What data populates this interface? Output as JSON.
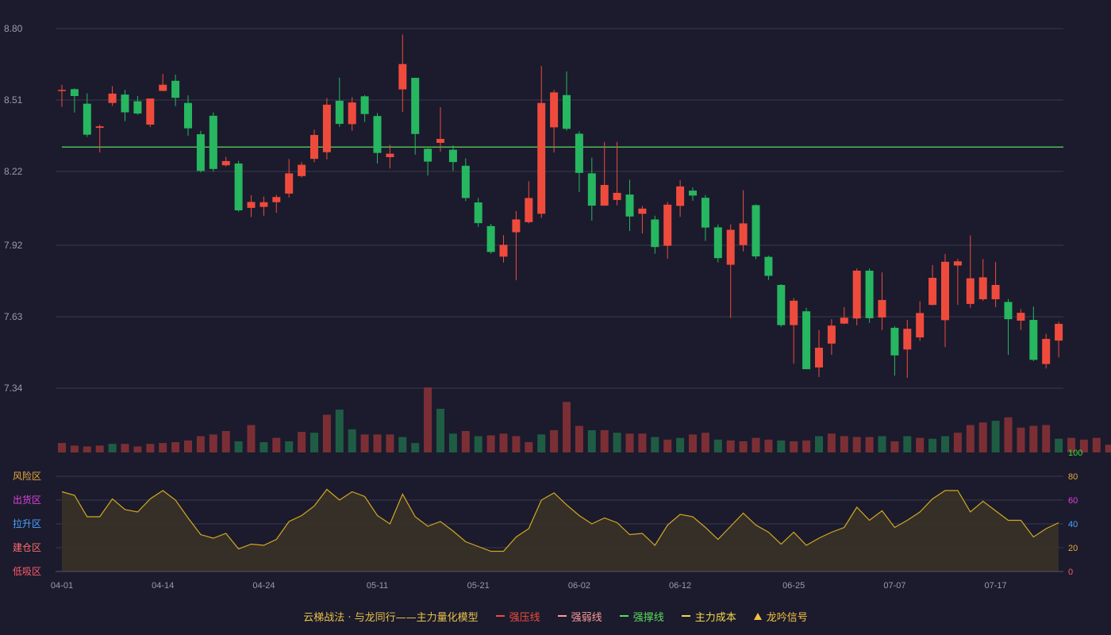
{
  "chart_data": {
    "type": "candlestick",
    "title": "",
    "dates": [
      "04-01",
      "04-02",
      "04-03",
      "04-07",
      "04-08",
      "04-09",
      "04-10",
      "04-11",
      "04-14",
      "04-15",
      "04-16",
      "04-17",
      "04-18",
      "04-21",
      "04-22",
      "04-23",
      "04-24",
      "04-25",
      "04-28",
      "04-29",
      "04-30",
      "05-06",
      "05-07",
      "05-08",
      "05-09",
      "05-11",
      "05-12",
      "05-13",
      "05-14",
      "05-15",
      "05-16",
      "05-19",
      "05-20",
      "05-21",
      "05-22",
      "05-23",
      "05-26",
      "05-27",
      "05-28",
      "05-29",
      "05-30",
      "06-02",
      "06-03",
      "06-04",
      "06-05",
      "06-06",
      "06-09",
      "06-10",
      "06-11",
      "06-12",
      "06-13",
      "06-16",
      "06-17",
      "06-18",
      "06-19",
      "06-20",
      "06-23",
      "06-24",
      "06-25",
      "06-26",
      "06-27",
      "06-30",
      "07-01",
      "07-02",
      "07-03",
      "07-04",
      "07-07",
      "07-08",
      "07-09",
      "07-10",
      "07-11",
      "07-14",
      "07-15",
      "07-16",
      "07-17",
      "07-18",
      "07-21",
      "07-22",
      "07-23",
      "07-24",
      "07-25",
      "07-28",
      "07-29",
      "07-30",
      "07-31"
    ],
    "x_tick_labels": [
      "04-01",
      "04-14",
      "04-24",
      "05-11",
      "05-21",
      "06-02",
      "06-12",
      "06-25",
      "07-07",
      "07-17"
    ],
    "price_y_ticks": [
      "8.80",
      "8.51",
      "8.22",
      "7.92",
      "7.63",
      "7.34"
    ],
    "price_ylim": [
      7.34,
      8.8
    ],
    "candles": [
      [
        8.551,
        8.551,
        8.572,
        8.482
      ],
      [
        8.554,
        8.526,
        8.557,
        8.459
      ],
      [
        8.495,
        8.369,
        8.537,
        8.36
      ],
      [
        8.397,
        8.403,
        8.41,
        8.297
      ],
      [
        8.498,
        8.536,
        8.566,
        8.486
      ],
      [
        8.532,
        8.46,
        8.551,
        8.424
      ],
      [
        8.505,
        8.455,
        8.526,
        8.45
      ],
      [
        8.41,
        8.516,
        8.516,
        8.4
      ],
      [
        8.547,
        8.572,
        8.616,
        8.546
      ],
      [
        8.588,
        8.519,
        8.613,
        8.485
      ],
      [
        8.498,
        8.395,
        8.529,
        8.365
      ],
      [
        8.371,
        8.222,
        8.385,
        8.216
      ],
      [
        8.446,
        8.23,
        8.46,
        8.219
      ],
      [
        8.245,
        8.262,
        8.279,
        8.24
      ],
      [
        8.252,
        8.062,
        8.263,
        8.056
      ],
      [
        8.072,
        8.096,
        8.123,
        8.035
      ],
      [
        8.076,
        8.095,
        8.118,
        8.04
      ],
      [
        8.095,
        8.116,
        8.125,
        8.052
      ],
      [
        8.13,
        8.212,
        8.27,
        8.114
      ],
      [
        8.201,
        8.247,
        8.258,
        8.195
      ],
      [
        8.271,
        8.368,
        8.39,
        8.257
      ],
      [
        8.298,
        8.491,
        8.518,
        8.269
      ],
      [
        8.507,
        8.413,
        8.601,
        8.401
      ],
      [
        8.412,
        8.5,
        8.522,
        8.385
      ],
      [
        8.525,
        8.453,
        8.53,
        8.421
      ],
      [
        8.445,
        8.295,
        8.457,
        8.252
      ],
      [
        8.278,
        8.292,
        8.328,
        8.232
      ],
      [
        8.553,
        8.656,
        8.776,
        8.461
      ],
      [
        8.6,
        8.372,
        8.6,
        8.288
      ],
      [
        8.312,
        8.26,
        8.314,
        8.203
      ],
      [
        8.336,
        8.352,
        8.481,
        8.3
      ],
      [
        8.308,
        8.258,
        8.326,
        8.222
      ],
      [
        8.243,
        8.112,
        8.273,
        8.1
      ],
      [
        8.094,
        8.01,
        8.112,
        7.995
      ],
      [
        7.998,
        7.893,
        8.007,
        7.886
      ],
      [
        7.874,
        7.922,
        7.961,
        7.85
      ],
      [
        7.973,
        8.025,
        8.059,
        7.778
      ],
      [
        8.014,
        8.112,
        8.18,
        8.009
      ],
      [
        8.048,
        8.498,
        8.648,
        8.031
      ],
      [
        8.399,
        8.541,
        8.551,
        8.297
      ],
      [
        8.53,
        8.393,
        8.626,
        8.386
      ],
      [
        8.373,
        8.214,
        8.383,
        8.136
      ],
      [
        8.212,
        8.081,
        8.276,
        8.02
      ],
      [
        8.081,
        8.165,
        8.34,
        8.081
      ],
      [
        8.104,
        8.133,
        8.34,
        8.082
      ],
      [
        8.126,
        8.037,
        8.186,
        7.978
      ],
      [
        8.048,
        8.069,
        8.08,
        7.968
      ],
      [
        8.025,
        7.913,
        8.04,
        7.886
      ],
      [
        7.918,
        8.085,
        8.096,
        7.865
      ],
      [
        8.08,
        8.159,
        8.184,
        8.036
      ],
      [
        8.142,
        8.122,
        8.155,
        8.101
      ],
      [
        8.113,
        7.992,
        8.124,
        7.938
      ],
      [
        7.993,
        7.868,
        8.005,
        7.851
      ],
      [
        7.841,
        7.983,
        8.005,
        7.625
      ],
      [
        7.921,
        8.009,
        8.144,
        7.895
      ],
      [
        8.083,
        7.875,
        8.086,
        7.864
      ],
      [
        7.873,
        7.796,
        7.878,
        7.779
      ],
      [
        7.759,
        7.596,
        7.762,
        7.589
      ],
      [
        7.596,
        7.695,
        7.706,
        7.439
      ],
      [
        7.652,
        7.417,
        7.666,
        7.418
      ],
      [
        7.424,
        7.504,
        7.576,
        7.385
      ],
      [
        7.521,
        7.594,
        7.62,
        7.475
      ],
      [
        7.602,
        7.626,
        7.669,
        7.6
      ],
      [
        7.623,
        7.817,
        7.826,
        7.595
      ],
      [
        7.817,
        7.624,
        7.826,
        7.605
      ],
      [
        7.627,
        7.698,
        7.81,
        7.576
      ],
      [
        7.585,
        7.473,
        7.592,
        7.391
      ],
      [
        7.497,
        7.581,
        7.617,
        7.382
      ],
      [
        7.546,
        7.645,
        7.693,
        7.532
      ],
      [
        7.678,
        7.788,
        7.84,
        7.676
      ],
      [
        7.616,
        7.853,
        7.885,
        7.507
      ],
      [
        7.838,
        7.855,
        7.865,
        7.678
      ],
      [
        7.682,
        7.786,
        7.96,
        7.666
      ],
      [
        7.701,
        7.79,
        7.864,
        7.694
      ],
      [
        7.701,
        7.759,
        7.852,
        7.669
      ],
      [
        7.69,
        7.62,
        7.702,
        7.475
      ],
      [
        7.614,
        7.646,
        7.661,
        7.576
      ],
      [
        7.617,
        7.455,
        7.671,
        7.45
      ],
      [
        7.438,
        7.54,
        7.561,
        7.42
      ],
      [
        7.533,
        7.601,
        7.61,
        7.465
      ]
    ],
    "volume": [
      11,
      8,
      7,
      8,
      10,
      10,
      7,
      10,
      11,
      12,
      14,
      19,
      21,
      25,
      13,
      32,
      12,
      17,
      13,
      24,
      23,
      44,
      50,
      27,
      21,
      21,
      21,
      18,
      11,
      76,
      51,
      22,
      25,
      19,
      20,
      22,
      19,
      12,
      21,
      26,
      59,
      31,
      26,
      26,
      23,
      22,
      22,
      18,
      15,
      17,
      21,
      23,
      15,
      14,
      13,
      17,
      15,
      14,
      13,
      14,
      19,
      22,
      19,
      18,
      18,
      19,
      13,
      19,
      17,
      16,
      19,
      23,
      32,
      35,
      37,
      41,
      29,
      31,
      32,
      16,
      17,
      15,
      17,
      9,
      12
    ],
    "volume_colors": [
      "up",
      "up",
      "up",
      "up",
      "down",
      "up",
      "up",
      "up",
      "up",
      "up",
      "up",
      "up",
      "up",
      "up",
      "down",
      "up",
      "down",
      "up",
      "down",
      "up",
      "down",
      "up",
      "down",
      "down",
      "up",
      "up",
      "up",
      "down",
      "down",
      "up",
      "down",
      "down",
      "up",
      "down",
      "up",
      "up",
      "up",
      "up",
      "down",
      "up",
      "up",
      "up",
      "down",
      "up",
      "down",
      "up",
      "up",
      "down",
      "up",
      "down",
      "up",
      "up",
      "down",
      "up",
      "up",
      "up",
      "up",
      "down",
      "up",
      "up",
      "down",
      "up",
      "up",
      "up",
      "up",
      "down",
      "up",
      "down",
      "up",
      "down",
      "down",
      "up",
      "up",
      "up",
      "down",
      "up",
      "up",
      "up",
      "up",
      "down",
      "up",
      "up",
      "up",
      "up",
      "up"
    ],
    "resistance_line": 8.319,
    "indicator": {
      "values": [
        67,
        64,
        46,
        46,
        61,
        52,
        50,
        61,
        68,
        60,
        45,
        31,
        28,
        32,
        19,
        23,
        22,
        27,
        42,
        47,
        55,
        69,
        60,
        67,
        63,
        47,
        40,
        65,
        46,
        38,
        42,
        34,
        25,
        21,
        17,
        17,
        29,
        36,
        60,
        66,
        56,
        47,
        40,
        45,
        41,
        31,
        32,
        22,
        39,
        48,
        46,
        37,
        27,
        38,
        49,
        39,
        33,
        23,
        33,
        22,
        28,
        33,
        37,
        54,
        43,
        51,
        37,
        43,
        50,
        61,
        68,
        68,
        50,
        59,
        51,
        43,
        43,
        29,
        36,
        41
      ],
      "y_ticks": [
        0,
        20,
        40,
        60,
        80,
        100
      ],
      "ylim": [
        0,
        100
      ],
      "zone_labels": [
        "风险区",
        "出货区",
        "拉升区",
        "建仓区",
        "低吸区"
      ],
      "zone_colors": [
        "#e8a93a",
        "#e040e0",
        "#4aa3ff",
        "#ff6b6b",
        "#ff5b6b"
      ]
    },
    "legend": [
      {
        "label": "云梯战法 · 与龙同行——主力量化模型",
        "style": "text",
        "color": "#e8c04a"
      },
      {
        "label": "强压线",
        "style": "solid",
        "color": "#ef4b3c"
      },
      {
        "label": "强弱线",
        "style": "dash",
        "color": "#ff9a9a"
      },
      {
        "label": "强撑线",
        "style": "solid",
        "color": "#5bdc5b"
      },
      {
        "label": "主力成本",
        "style": "dash",
        "color": "#f5d64a"
      },
      {
        "label": "龙吟信号",
        "style": "triangle",
        "color": "#f5c040"
      }
    ],
    "colors": {
      "up": "#ef4b3c",
      "down": "#26b760",
      "vol_up": "#7b2f35",
      "vol_down": "#1f5c44",
      "indicator_line": "#d4a820",
      "grid": "#3a3a4d",
      "support": "#5bdc5b"
    }
  }
}
